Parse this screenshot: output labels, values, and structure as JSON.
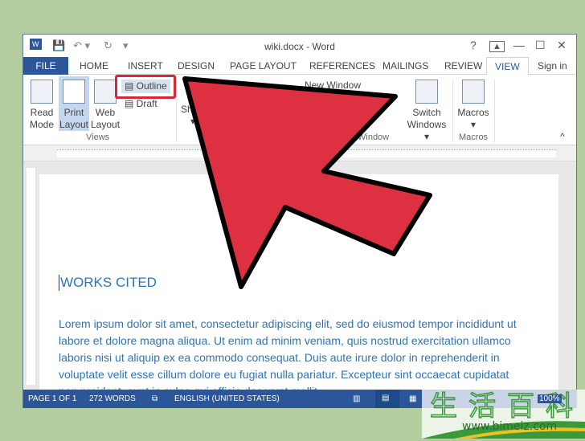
{
  "window": {
    "title": "wiki.docx - Word",
    "quick_access": [
      "word-icon",
      "save-icon",
      "undo-icon",
      "redo-icon",
      "customize-icon"
    ],
    "controls": [
      "?",
      "restore-ribbon-icon",
      "—",
      "☐",
      "✕"
    ]
  },
  "tabs": {
    "file": "FILE",
    "items": [
      "HOME",
      "INSERT",
      "DESIGN",
      "PAGE LAYOUT",
      "REFERENCES",
      "MAILINGS",
      "REVIEW"
    ],
    "active": "VIEW",
    "sign_in": "Sign in"
  },
  "ribbon": {
    "read_mode": [
      "Read",
      "Mode"
    ],
    "print_layout": [
      "Print",
      "Layout"
    ],
    "web_layout": [
      "Web",
      "Layout"
    ],
    "outline": "Outline",
    "draft": "Draft",
    "show": "Show",
    "new_window": "New Window",
    "switch_windows": [
      "Switch",
      "Windows ▾"
    ],
    "macros": [
      "Macros",
      "▾"
    ],
    "groups": {
      "views": "Views",
      "window": "Window",
      "macros": "Macros"
    }
  },
  "document": {
    "heading": "WORKS CITED",
    "paragraph": "Lorem ipsum dolor sit amet, consectetur adipiscing elit, sed do eiusmod tempor incididunt ut labore et dolore magna aliqua. Ut enim ad minim veniam, quis nostrud exercitation ullamco laboris nisi ut aliquip ex ea commodo consequat. Duis aute irure dolor in reprehenderit in voluptate velit esse cillum dolore eu fugiat nulla pariatur. Excepteur sint occaecat cupidatat non proident, sunt in culpa qui officia deserunt mollit"
  },
  "status": {
    "page": "PAGE 1 OF 1",
    "words": "272 WORDS",
    "language": "ENGLISH (UNITED STATES)",
    "zoom": "100%"
  },
  "watermark": {
    "chars": "生活百科",
    "url": "www.bimeiz.com"
  },
  "colors": {
    "accent": "#2b579a",
    "arrow": "#dd3040",
    "heading": "#2e74b5"
  }
}
